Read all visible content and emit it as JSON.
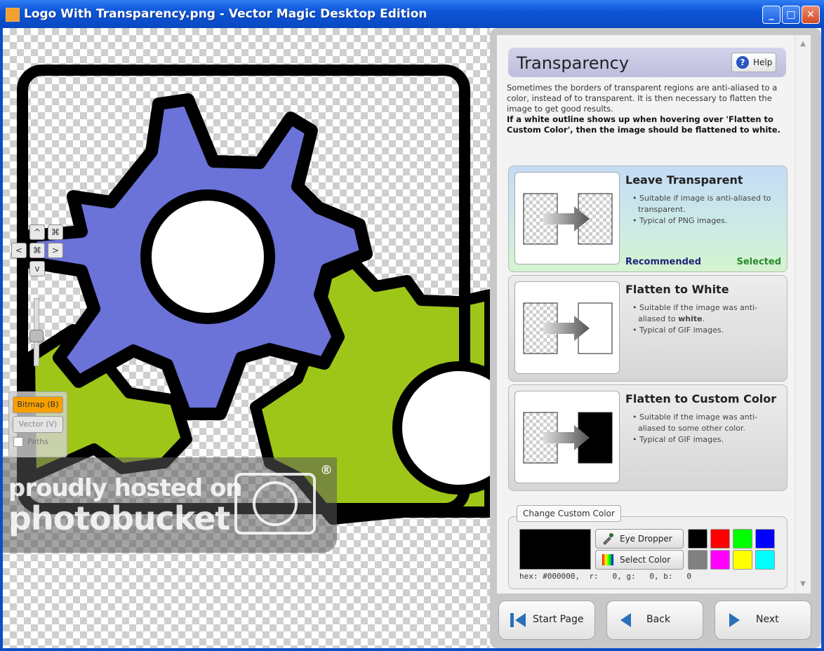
{
  "window": {
    "title": "Logo With Transparency.png - Vector Magic Desktop Edition",
    "minimize": "_",
    "maximize": "□",
    "close": "✕"
  },
  "viewer": {
    "nav": {
      "up": "^",
      "down": "v",
      "left": "<",
      "right": ">",
      "fit": "⌘"
    },
    "view_bitmap": "Bitmap (B)",
    "view_vector": "Vector (V)",
    "paths_label": "Paths",
    "colors": {
      "gear_blue": "#6b72d8",
      "gear_green": "#9ec618",
      "outline": "#000000"
    }
  },
  "watermark": {
    "line1": "proudly hosted on",
    "line2": "photobucket",
    "reg": "®"
  },
  "panel": {
    "title": "Transparency",
    "help_label": "Help",
    "description": "Sometimes the borders of transparent regions are anti-aliased to a color, instead of to transparent. It is then necessary to flatten the image to get good results.",
    "description_bold": "If a white outline shows up when hovering over 'Flatten to Custom Color', then the image should be flattened to white.",
    "options": [
      {
        "title": "Leave Transparent",
        "bullet1": "Suitable if image is anti-aliased to transparent.",
        "bullet2": "Typical of PNG images.",
        "recommended": "Recommended",
        "selected": "Selected"
      },
      {
        "title": "Flatten to White",
        "bullet1a": "Suitable if the image was anti-aliased to ",
        "bullet1b": "white",
        "bullet1c": ".",
        "bullet2": "Typical of GIF images."
      },
      {
        "title": "Flatten to Custom Color",
        "bullet1": "Suitable if the image was anti-aliased to some other color.",
        "bullet2": "Typical of GIF images."
      }
    ],
    "custom_color": {
      "group_label": "Change Custom Color",
      "current_color": "#000000",
      "eye_dropper": "Eye Dropper",
      "select_color": "Select Color",
      "palette": [
        "#000000",
        "#ff0000",
        "#00ff00",
        "#0000ff",
        "#808080",
        "#ff00ff",
        "#ffff00",
        "#00ffff"
      ],
      "hex_readout": "hex: #000000,  r:   0, g:   0, b:   0"
    }
  },
  "nav_buttons": {
    "start": "Start Page",
    "back": "Back",
    "next": "Next"
  }
}
